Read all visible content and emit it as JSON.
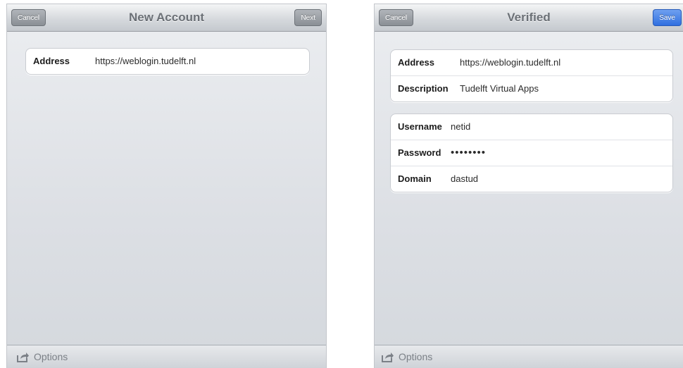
{
  "left": {
    "cancel_label": "Cancel",
    "title": "New Account",
    "next_label": "Next",
    "address_label": "Address",
    "address_value": "https://weblogin.tudelft.nl",
    "options_label": "Options"
  },
  "right": {
    "cancel_label": "Cancel",
    "title": "Verified",
    "save_label": "Save",
    "server_rows": [
      {
        "label": "Address",
        "value": "https://weblogin.tudelft.nl"
      },
      {
        "label": "Description",
        "value": "Tudelft Virtual Apps"
      }
    ],
    "credential_rows": [
      {
        "label": "Username",
        "value": "netid"
      },
      {
        "label": "Password",
        "value": "••••••••"
      },
      {
        "label": "Domain",
        "value": "dastud"
      }
    ],
    "options_label": "Options"
  },
  "icons": {
    "options": "share-icon"
  },
  "colors": {
    "save_button": "#2f6fe0",
    "nav_title": "#6b7076"
  }
}
